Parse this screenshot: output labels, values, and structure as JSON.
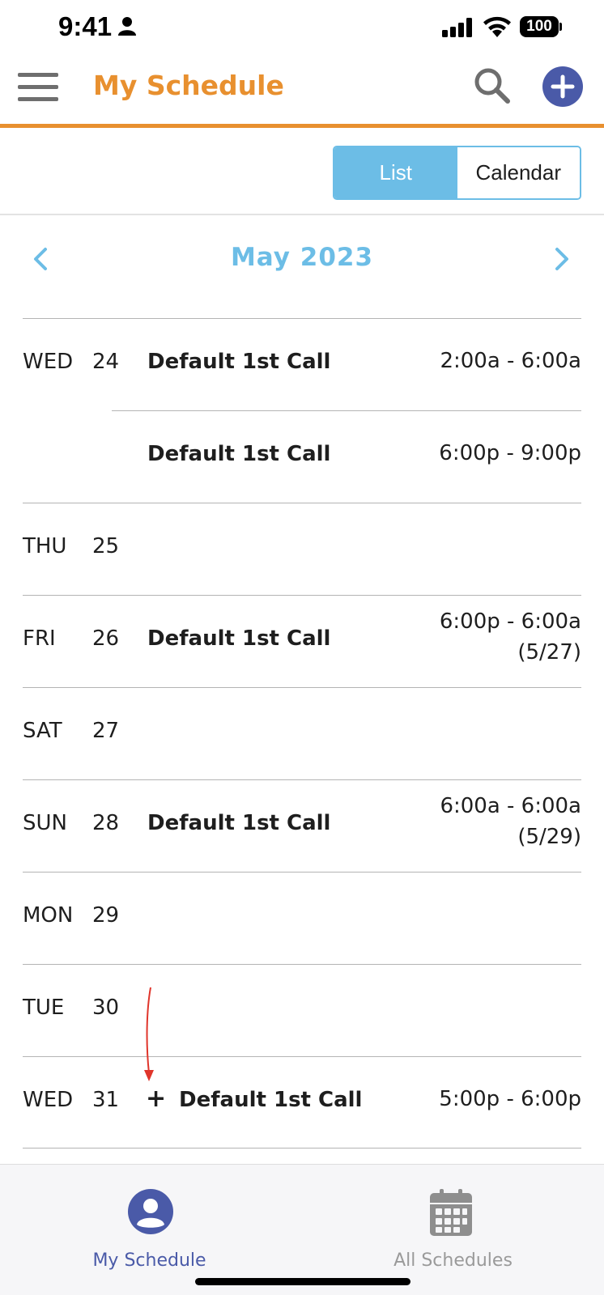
{
  "status_bar": {
    "time": "9:41",
    "battery": "100"
  },
  "header": {
    "title": "My Schedule",
    "menu_icon": "hamburger-icon",
    "search_icon": "search-icon",
    "add_icon": "plus-circle-icon"
  },
  "view_toggle": {
    "list_label": "List",
    "calendar_label": "Calendar",
    "selected": "List"
  },
  "month_nav": {
    "label": "May 2023"
  },
  "days": [
    {
      "dow": "WED",
      "day": "24",
      "shift": "Default 1st Call",
      "time": "2:00a - 6:00a",
      "time2": ""
    },
    {
      "dow": "",
      "day": "",
      "shift": "Default 1st Call",
      "time": "6:00p - 9:00p",
      "time2": ""
    },
    {
      "dow": "THU",
      "day": "25",
      "shift": "",
      "time": "",
      "time2": ""
    },
    {
      "dow": "FRI",
      "day": "26",
      "shift": "Default 1st Call",
      "time": "6:00p - 6:00a",
      "time2": "(5/27)"
    },
    {
      "dow": "SAT",
      "day": "27",
      "shift": "",
      "time": "",
      "time2": ""
    },
    {
      "dow": "SUN",
      "day": "28",
      "shift": "Default 1st Call",
      "time": "6:00a - 6:00a",
      "time2": "(5/29)"
    },
    {
      "dow": "MON",
      "day": "29",
      "shift": "",
      "time": "",
      "time2": ""
    },
    {
      "dow": "TUE",
      "day": "30",
      "shift": "",
      "time": "",
      "time2": ""
    },
    {
      "dow": "WED",
      "day": "31",
      "plus": "+",
      "shift": "Default 1st Call",
      "time": "5:00p - 6:00p",
      "time2": ""
    }
  ],
  "tab_bar": {
    "my_schedule_label": "My Schedule",
    "all_schedules_label": "All Schedules",
    "active": "My Schedule"
  },
  "colors": {
    "accent_orange": "#e8902f",
    "accent_blue": "#6cbde6",
    "brand_indigo": "#4a5aa8",
    "annotation_red": "#e0352b"
  }
}
